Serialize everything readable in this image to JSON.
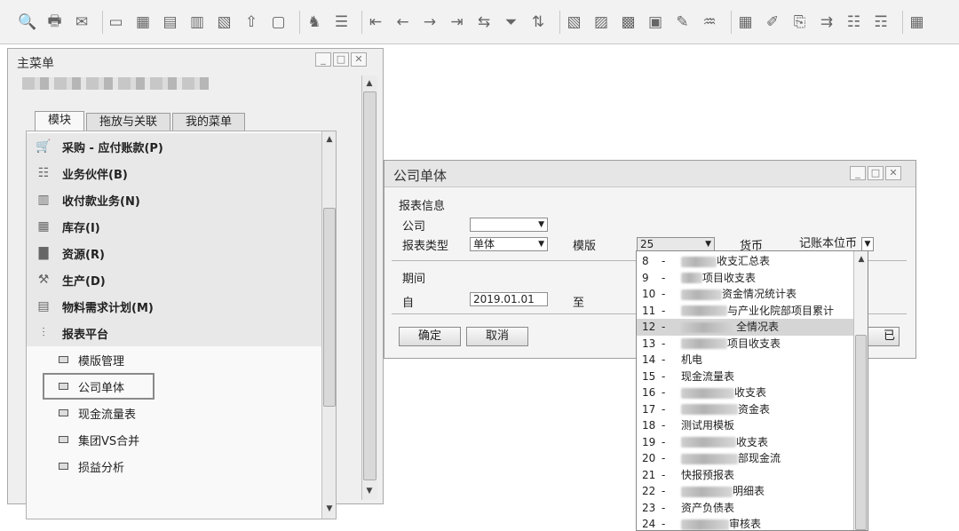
{
  "toolbar": {
    "icons": [
      "preview-icon",
      "print-icon",
      "email-icon",
      "sms-icon",
      "fax-icon",
      "export-excel-icon",
      "export-word-icon",
      "export-pdf-icon",
      "launch-icon",
      "lock-screen-icon",
      "find-icon",
      "add-icon",
      "first-record-icon",
      "previous-record-icon",
      "next-record-icon",
      "last-record-icon",
      "refresh-icon",
      "filter-icon",
      "sort-icon",
      "base-document-icon",
      "target-document-icon",
      "layout-designer-icon",
      "gross-profit-icon",
      "payment-means-icon",
      "settings-icon",
      "transaction-journal-icon",
      "edit-icon",
      "copy-icon",
      "approve-icon",
      "message-icon",
      "messages-icon",
      "calendar-icon"
    ],
    "glyphs": [
      "🔍",
      "🖶",
      "✉",
      "▭",
      "▦",
      "▤",
      "▥",
      "▧",
      "⇧",
      "▢",
      "♞",
      "☰",
      "⇤",
      "←",
      "→",
      "⇥",
      "⇆",
      "⏷",
      "⇅",
      "▧",
      "▨",
      "▩",
      "▣",
      "✎",
      "♒",
      "▦",
      "✐",
      "⎘",
      "⇉",
      "☷",
      "☶",
      "▦"
    ]
  },
  "menu": {
    "title": "主菜单",
    "tabs": [
      "模块",
      "拖放与关联",
      "我的菜单"
    ],
    "modules": [
      {
        "label": "采购 - 应付账款(P)",
        "icon": "cart-icon",
        "glyph": "🛒"
      },
      {
        "label": "业务伙伴(B)",
        "icon": "partners-icon",
        "glyph": "☷"
      },
      {
        "label": "收付款业务(N)",
        "icon": "banking-icon",
        "glyph": "▥"
      },
      {
        "label": "库存(I)",
        "icon": "inventory-icon",
        "glyph": "▦"
      },
      {
        "label": "资源(R)",
        "icon": "resources-icon",
        "glyph": "▇"
      },
      {
        "label": "生产(D)",
        "icon": "production-icon",
        "glyph": "⚒"
      },
      {
        "label": "物料需求计划(M)",
        "icon": "mrp-icon",
        "glyph": "▤"
      },
      {
        "label": "报表平台",
        "icon": "reports-icon",
        "glyph": "⫶"
      }
    ],
    "subitems": [
      "模版管理",
      "公司单体",
      "现金流量表",
      "集团VS合并",
      "损益分析"
    ]
  },
  "dialog": {
    "title": "公司单体",
    "section_report_info": "报表信息",
    "company_label": "公司",
    "company_value": "",
    "report_type_label": "报表类型",
    "report_type_value": "单体",
    "template_label": "模版",
    "template_value": "25",
    "currency_label": "货币",
    "currency_value": "记账本位币",
    "section_period": "期间",
    "from_label": "自",
    "from_value": "2019.01.01",
    "to_label": "至",
    "ok_label": "确定",
    "cancel_label": "取消",
    "hidden_button_tail": "已"
  },
  "dropdown": {
    "items": [
      {
        "num": "8",
        "text": "收支汇总表"
      },
      {
        "num": "9",
        "text": "项目收支表"
      },
      {
        "num": "10",
        "text": "资金情况统计表"
      },
      {
        "num": "11",
        "text": "与产业化院部项目累计"
      },
      {
        "num": "12",
        "text": "全情况表"
      },
      {
        "num": "13",
        "text": "项目收支表"
      },
      {
        "num": "14",
        "text": "机电"
      },
      {
        "num": "15",
        "text": "现金流量表"
      },
      {
        "num": "16",
        "text": "收支表"
      },
      {
        "num": "17",
        "text": "资金表"
      },
      {
        "num": "18",
        "text": "测试用模板"
      },
      {
        "num": "19",
        "text": "收支表"
      },
      {
        "num": "20",
        "text": "部现金流"
      },
      {
        "num": "21",
        "text": "快报预报表"
      },
      {
        "num": "22",
        "text": "明细表"
      },
      {
        "num": "23",
        "text": "资产负债表"
      },
      {
        "num": "24",
        "text": "审核表"
      }
    ],
    "highlighted": "12"
  }
}
